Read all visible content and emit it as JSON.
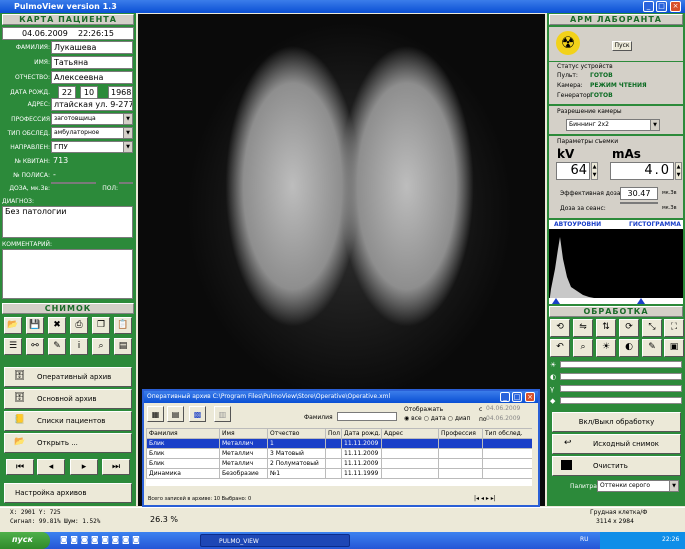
{
  "window": {
    "title": "PulmoView  version 1.3"
  },
  "patient": {
    "header": "КАРТА ПАЦИЕНТА",
    "date": "04.06.2009",
    "time": "22:26:15",
    "surname_label": "ФАМИЛИЯ:",
    "surname": "Лукашева",
    "name_label": "ИМЯ:",
    "name": "Татьяна",
    "patronymic_label": "ОТЧЕСТВО:",
    "patronymic": "Алексеевна",
    "birth_label": "ДАТА РОЖД.",
    "birth_day": "22",
    "birth_month": "10",
    "birth_year": "1968",
    "address_label": "АДРЕС:",
    "address": "лтайская ул. 9-277",
    "profession_label": "ПРОФЕССИЯ",
    "profession": "заготовщица",
    "exam_label": "ТИП ОБСЛЕД.",
    "exam": "амбулаторное",
    "referral_label": "НАПРАВЛЕН:",
    "referral": "ГПУ",
    "receipt_label": "№ КВИТАН:",
    "receipt": "713",
    "policy_label": "№ ПОЛИСА:",
    "policy": "-",
    "dose_label": "ДОЗА, мк.Зв:",
    "sex_label": "ПОЛ:",
    "diagnosis_label": "ДИАГНОЗ:",
    "diagnosis": "Без патологии",
    "comment_label": "КОММЕНТАРИЙ:"
  },
  "snapshot": {
    "header": "СНИМОК"
  },
  "archive_buttons": [
    "Оперативный архив",
    "Основной архив",
    "Списки пациентов",
    "Открыть ..."
  ],
  "archive_settings": "Настройка архивов",
  "status_left": {
    "coords": "X: 2901 Y:   725",
    "signal": "Сигнал: 99.81%  Шум: 1.52%"
  },
  "zoom": "26.3 %",
  "lab": {
    "header": "АРМ ЛАБОРАНТА",
    "start_button": "Пуск",
    "device_status_label": "Статус устройств",
    "console_label": "Пульт:",
    "console_val": "ГОТОВ",
    "camera_label": "Камера:",
    "camera_val": "РЕЖИМ ЧТЕНИЯ",
    "generator_label": "Генератор:",
    "generator_val": "ГОТОВ",
    "resolution_label": "Разрешение камеры",
    "resolution_val": "Биннинг 2x2",
    "params_label": "Параметры съемки",
    "kv_label": "kV",
    "kv_val": "64",
    "mas_label": "mAs",
    "mas_val": "4.0",
    "eff_dose_label": "Эффективная доза:",
    "eff_dose_val": "30.47",
    "dose_unit": "мк.Зв",
    "session_dose_label": "Доза за сеанс:",
    "session_dose_unit": "мк.Зв",
    "auto_levels": "АВТОУРОВНИ",
    "histogram": "ГИСТОГРАММА"
  },
  "processing": {
    "header": "ОБРАБОТКА",
    "toggle_button": "Вкл/Выкл обработку",
    "original_button": "Исходный снимок",
    "clear_button": "Очистить",
    "palette_label": "Палитра:",
    "palette_val": "Оттенки серого"
  },
  "status_right": {
    "exam_type": "Грудная клетка/Ф",
    "size": "3114 x 2984"
  },
  "archive_window": {
    "title": "Оперативный архив       C:\\Program Files\\PulmoView\\Store\\Operative\\Operative.xml",
    "surname_label": "Фамилия",
    "display_label": "Отображать",
    "radio_all": "все",
    "radio_date": "дата",
    "radio_range": "диап",
    "from_label": "с",
    "from_date": "04.06.2009",
    "to_label": "по",
    "to_date": "04.06.2009",
    "columns": [
      "Фамилия",
      "Имя",
      "Отчество",
      "Пол",
      "Дата рожд.",
      "Адрес",
      "Профессия",
      "Тип обслед."
    ],
    "rows": [
      [
        "Блик",
        "Металлич",
        "1",
        "",
        "11.11.2009",
        "",
        "",
        ""
      ],
      [
        "Блик",
        "Металлич",
        "3 Матовый",
        "",
        "11.11.2009",
        "",
        "",
        ""
      ],
      [
        "Блик",
        "Металлич",
        "2 Полуматовый",
        "",
        "11.11.2009",
        "",
        "",
        ""
      ],
      [
        "Динамика",
        "Безобразие",
        "№1",
        "",
        "11.11.1999",
        "",
        "",
        ""
      ]
    ],
    "footer": "Всего записей в архиве: 10  Выбрано: 0"
  },
  "taskbar": {
    "start": "пуск",
    "task": "PULMO_VIEW",
    "lang": "RU",
    "clock": "22:26"
  }
}
